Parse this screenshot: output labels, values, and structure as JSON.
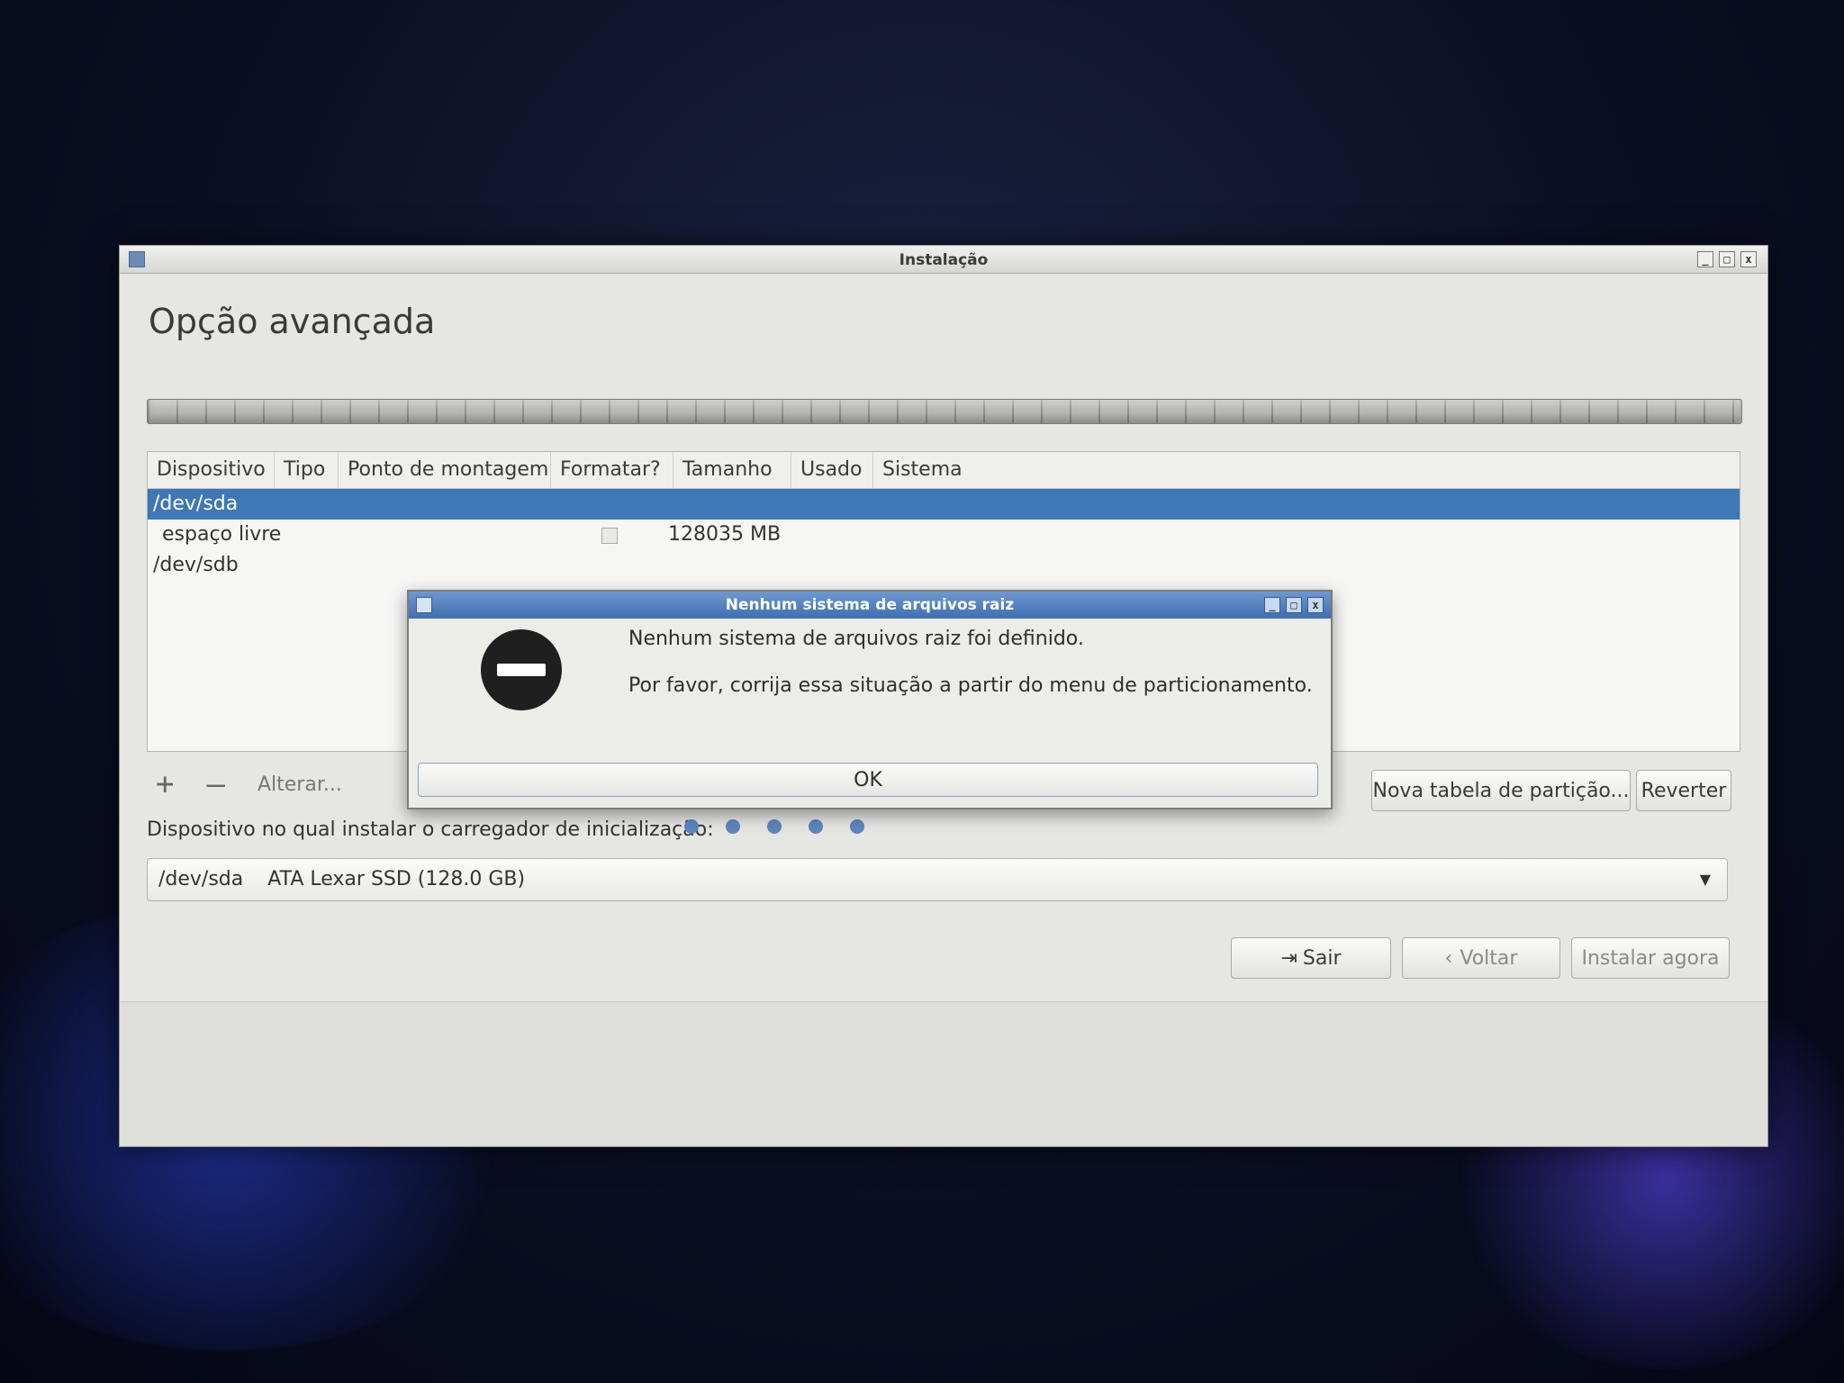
{
  "window": {
    "title": "Instalação",
    "heading": "Opção avançada",
    "controls": {
      "minimize": "_",
      "maximize": "□",
      "close": "x"
    }
  },
  "table": {
    "columns": [
      "Dispositivo",
      "Tipo",
      "Ponto de montagem",
      "Formatar?",
      "Tamanho",
      "Usado",
      "Sistema"
    ],
    "rows": [
      {
        "device": "/dev/sda",
        "size": "",
        "selected": true
      },
      {
        "device": "espaço livre",
        "size": "128035 MB",
        "format_checked": false
      },
      {
        "device": "/dev/sdb",
        "size": ""
      }
    ]
  },
  "tools": {
    "add": "+",
    "remove": "—",
    "change": "Alterar..."
  },
  "buttons": {
    "new_table": "Nova tabela de partição...",
    "revert": "Reverter",
    "quit": "Sair",
    "back": "Voltar",
    "install": "Instalar agora"
  },
  "bootloader": {
    "label": "Dispositivo no qual instalar o carregador de inicialização:",
    "device": "/dev/sda",
    "description": "ATA Lexar SSD (128.0 GB)"
  },
  "dialog": {
    "title": "Nenhum sistema de arquivos raiz",
    "message": "Nenhum sistema de arquivos raiz foi definido.",
    "detail": "Por favor, corrija essa situação a partir do menu de particionamento.",
    "ok": "OK"
  },
  "progress_dots": {
    "count": 5,
    "color": "#5f86bb"
  },
  "colors": {
    "selection": "#3f78b5",
    "dialog_title": "#3f6fb0"
  }
}
